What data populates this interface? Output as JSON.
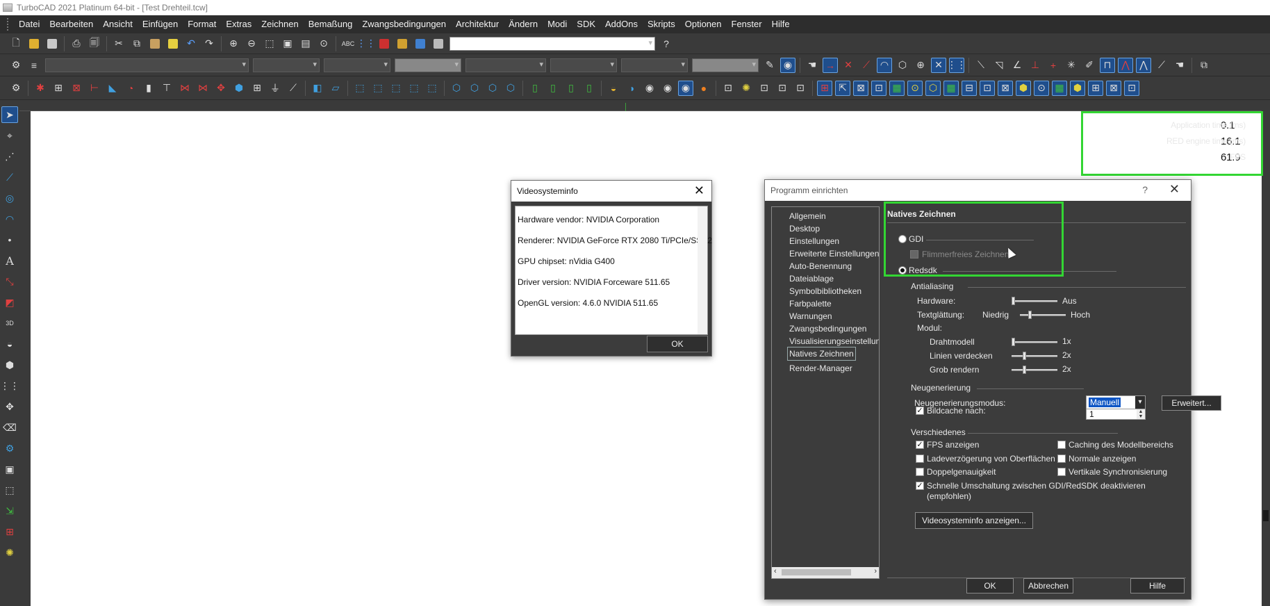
{
  "window": {
    "title": "TurboCAD 2021 Platinum 64-bit - [Test Drehteil.tcw]"
  },
  "menu": [
    "Datei",
    "Bearbeiten",
    "Ansicht",
    "Einfügen",
    "Format",
    "Extras",
    "Zeichnen",
    "Bemaßung",
    "Zwangsbedingungen",
    "Architektur",
    "Ändern",
    "Modi",
    "SDK",
    "AddOns",
    "Skripts",
    "Optionen",
    "Fenster",
    "Hilfe"
  ],
  "stats": {
    "app_time_label": "Application time (ms)",
    "app_time_value": "0.1",
    "red_time_label": "RED engine time (ms)",
    "red_time_value": "16.1",
    "fps_label": "FPS",
    "fps_value": "61.9"
  },
  "video_dialog": {
    "title": "Videosysteminfo",
    "lines": [
      "Hardware vendor: NVIDIA Corporation",
      "Renderer: NVIDIA GeForce RTX 2080 Ti/PCIe/SSE2",
      "GPU chipset: nVidia G400",
      "Driver version: NVIDIA Forceware 511.65",
      "OpenGL version: 4.6.0 NVIDIA 511.65"
    ],
    "ok_label": "OK"
  },
  "prog_dialog": {
    "title": "Programm einrichten",
    "help": "?",
    "tree": [
      "Allgemein",
      "Desktop",
      "Einstellungen",
      "Erweiterte Einstellungen",
      "Auto-Benennung",
      "Dateiablage",
      "Symbolbibliotheken",
      "Farbpalette",
      "Warnungen",
      "Zwangsbedingungen",
      "Visualisierungseinstellun",
      "Natives Zeichnen",
      "Render-Manager"
    ],
    "selected_tree": "Natives Zeichnen",
    "section_title": "Natives Zeichnen",
    "gdi_label": "GDI",
    "flicker_label": "Flimmerfreies Zeichnen",
    "redsdk_label": "Redsdk",
    "antialiasing_label": "Antialiasing",
    "hardware_label": "Hardware:",
    "hardware_value": "Aus",
    "text_label": "Textglättung:",
    "text_low": "Niedrig",
    "text_high": "Hoch",
    "modul_label": "Modul:",
    "wire_label": "Drahtmodell",
    "wire_value": "1x",
    "hidden_label": "Linien verdecken",
    "hidden_value": "2x",
    "rough_label": "Grob rendern",
    "rough_value": "2x",
    "regen_section": "Neugenerierung",
    "regen_mode_label": "Neugenerierungsmodus:",
    "regen_mode_value": "Manuell",
    "advanced_label": "Erweitert...",
    "cache_label": "Bildcache nach:",
    "cache_value": "1",
    "misc_section": "Verschiedenes",
    "fps_show": "FPS anzeigen",
    "model_cache": "Caching des Modellbereichs",
    "load_delay": "Ladeverzögerung von Oberflächen",
    "show_normals": "Normale anzeigen",
    "double_precision": "Doppelgenauigkeit",
    "vsync": "Vertikale Synchronisierung",
    "fast_switch": "Schnelle Umschaltung zwischen GDI/RedSDK deaktivieren",
    "fast_switch_2": "(empfohlen)",
    "videoinfo_btn": "Videosysteminfo anzeigen...",
    "ok_label": "OK",
    "cancel_label": "Abbrechen",
    "help_label": "Hilfe"
  },
  "colors": {
    "highlight": "#33d633",
    "selection": "#0f56c5",
    "ui_dark": "#3a3a3a"
  }
}
